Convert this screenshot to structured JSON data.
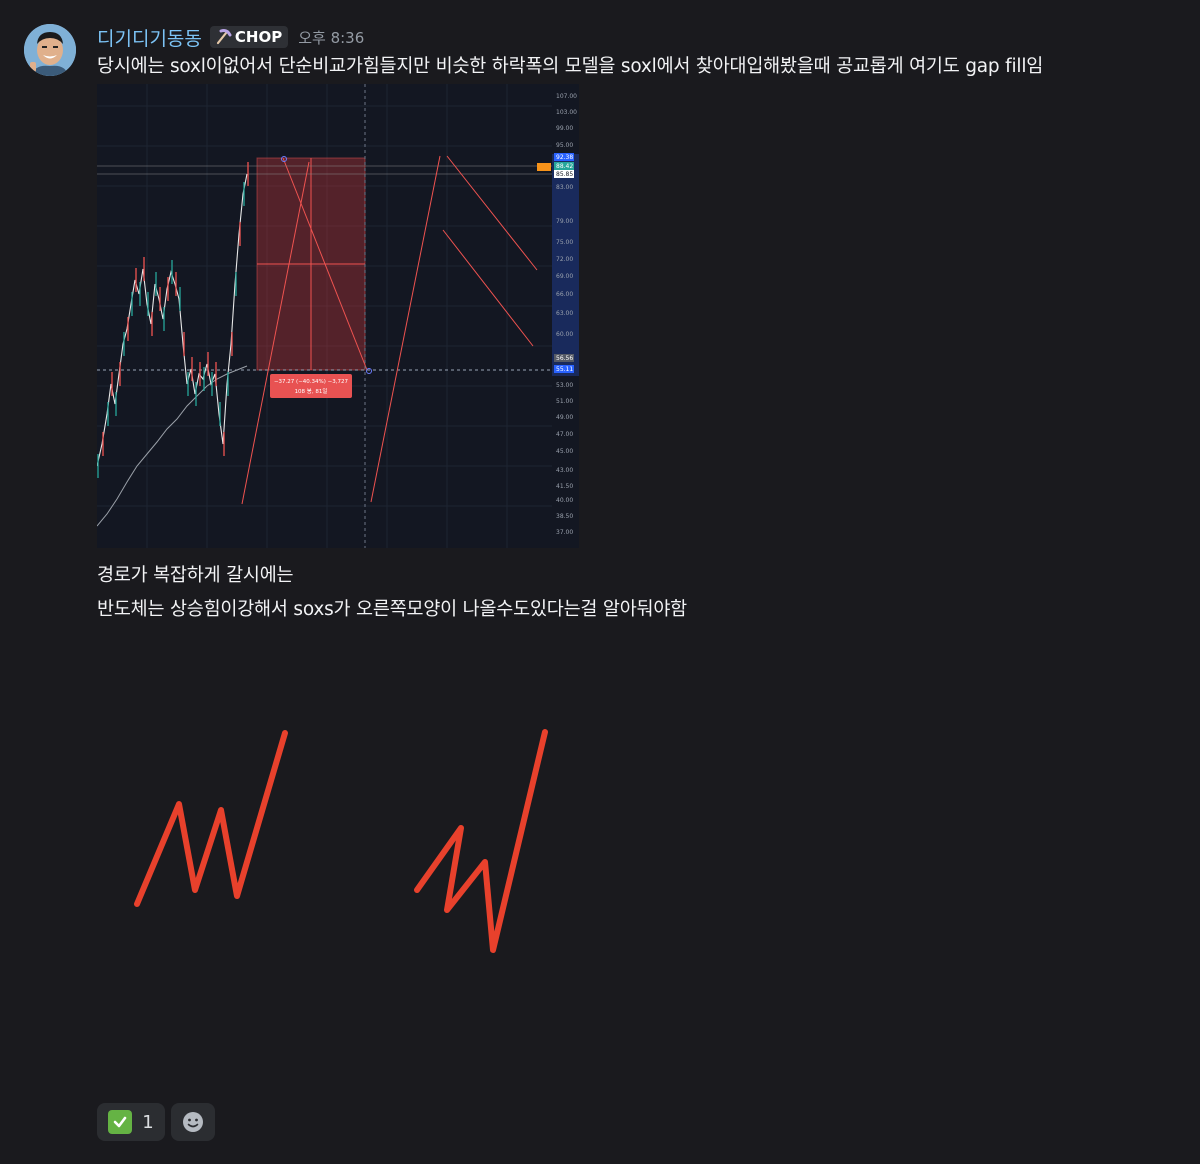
{
  "message": {
    "author": "디기디기동동",
    "role_tag": "CHOP",
    "role_icon": "pickaxe-icon",
    "timestamp": "오후 8:36",
    "lines": [
      "당시에는 soxl이없어서 단순비교가힘들지만 비슷한 하락폭의 모델을 soxl에서 찾아대입해봤을때 공교롭게 여기도 gap fill임",
      "경로가 복잡하게 갈시에는",
      "반도체는 상승힘이강해서 soxs가 오른쪽모양이 나올수도있다는걸 알아둬야함"
    ]
  },
  "chart_attachment": {
    "price_axis": [
      "107.00",
      "103.00",
      "99.00",
      "95.00",
      "92.38",
      "88.42",
      "85.85",
      "83.00",
      "79.00",
      "75.00",
      "72.00",
      "69.00",
      "66.00",
      "63.00",
      "60.00",
      "56.56",
      "55.11",
      "53.00",
      "51.00",
      "49.00",
      "47.00",
      "45.00",
      "43.00",
      "41.50",
      "40.00",
      "38.50",
      "37.00"
    ],
    "measure_label_line1": "−37.27 (−40.34%) −3,727",
    "measure_label_line2": "108 봉, 81일",
    "colors": {
      "up": "#26a69a",
      "down": "#ef5350",
      "highlight": "#2962ff",
      "measure_box": "#e03c3c"
    }
  },
  "drawing": {
    "color": "#e8412c",
    "icons": [
      "zigzag-sketch-left",
      "zigzag-sketch-right"
    ]
  },
  "reactions": [
    {
      "icon": "check-mark-icon",
      "count": "1"
    },
    {
      "icon": "add-reaction-icon"
    }
  ]
}
